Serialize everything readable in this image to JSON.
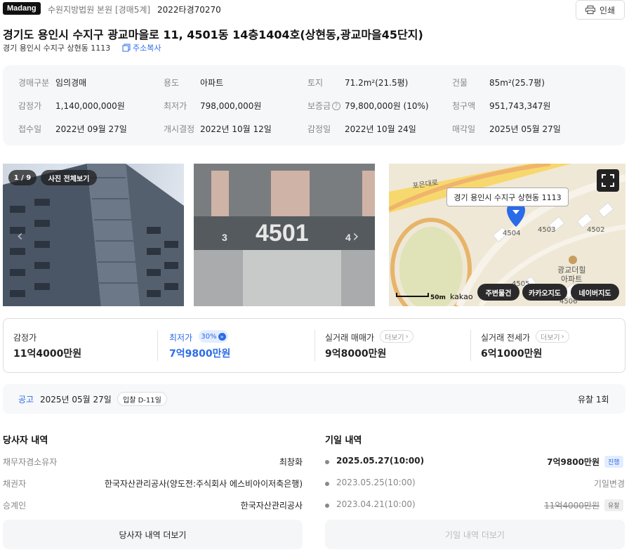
{
  "header": {
    "logo": "Madang",
    "court": "수원지방법원 본원 [경매5계]",
    "case_no": "2022타경70270",
    "print_label": "인쇄"
  },
  "title": "경기도 용인시 수지구 광교마을로 11, 4501동 14층1404호(상현동,광교마을45단지)",
  "sub_address": "경기 용인시 수지구 상현동 1113",
  "copy_label": "주소복사",
  "info": [
    [
      {
        "label": "경매구분",
        "value": "임의경매"
      },
      {
        "label": "용도",
        "value": "아파트"
      },
      {
        "label": "토지",
        "value": "71.2m²(21.5평)"
      },
      {
        "label": "건물",
        "value": "85m²(25.7평)"
      }
    ],
    [
      {
        "label": "감정가",
        "value": "1,140,000,000원"
      },
      {
        "label": "최저가",
        "value": "798,000,000원"
      },
      {
        "label": "보증금",
        "value": "79,800,000원 (10%)"
      },
      {
        "label": "청구액",
        "value": "951,743,347원"
      }
    ],
    [
      {
        "label": "접수일",
        "value": "2022년 09월 27일"
      },
      {
        "label": "개시결정",
        "value": "2022년 10월 12일"
      },
      {
        "label": "감정일",
        "value": "2022년 10월 24일"
      },
      {
        "label": "매각일",
        "value": "2025년 05월 27일"
      }
    ]
  ],
  "photos": {
    "counter": "1 / 9",
    "all_label": "사진 전체보기",
    "building_no": "4501",
    "plate_left": "3",
    "plate_right": "4"
  },
  "map": {
    "road": "포은대로",
    "address_tip": "경기 용인시 수지구 상현동 1113",
    "bldgs": [
      "4503",
      "4502",
      "4504",
      "4505",
      "4506"
    ],
    "poi": "광교더힐\n아파트",
    "poi_1": "광교더힐",
    "poi_2": "아파트",
    "scale": "50m",
    "brand": "kakao",
    "btn_near": "주변물건",
    "btn_kakao": "카카오지도",
    "btn_naver": "네이버지도"
  },
  "prices": {
    "appraisal_label": "감정가",
    "appraisal": "11억4000만원",
    "min_label": "최저가",
    "min_pct": "30%",
    "min": "7억9800만원",
    "sale_label": "실거래 매매가",
    "sale": "9억8000만원",
    "rent_label": "실거래 전세가",
    "rent": "6억1000만원",
    "more": "더보기"
  },
  "notice": {
    "label": "공고",
    "date": "2025년 05월 27일",
    "dday": "입찰 D-11일",
    "result": "유찰 1회"
  },
  "parties": {
    "title": "당사자 내역",
    "rows": [
      {
        "label": "채무자겸소유자",
        "value": "최창화"
      },
      {
        "label": "채권자",
        "value": "한국자산관리공사(양도전:주식회사 에스비아이저축은행)"
      },
      {
        "label": "승계인",
        "value": "한국자산관리공사"
      }
    ],
    "more": "당사자 내역 더보기"
  },
  "schedule": {
    "title": "기일 내역",
    "rows": [
      {
        "date": "2025.05.27(10:00)",
        "value": "7억9800만원",
        "tag": "진행"
      },
      {
        "date": "2023.05.25(10:00)",
        "value": "기일변경",
        "tag": ""
      },
      {
        "date": "2023.04.21(10:00)",
        "value": "11억4000만원",
        "tag": "유찰"
      }
    ],
    "more": "기일 내역 더보기"
  },
  "colors": {
    "accent": "#2b6be8",
    "ink": "#222222",
    "muted": "#888888"
  }
}
